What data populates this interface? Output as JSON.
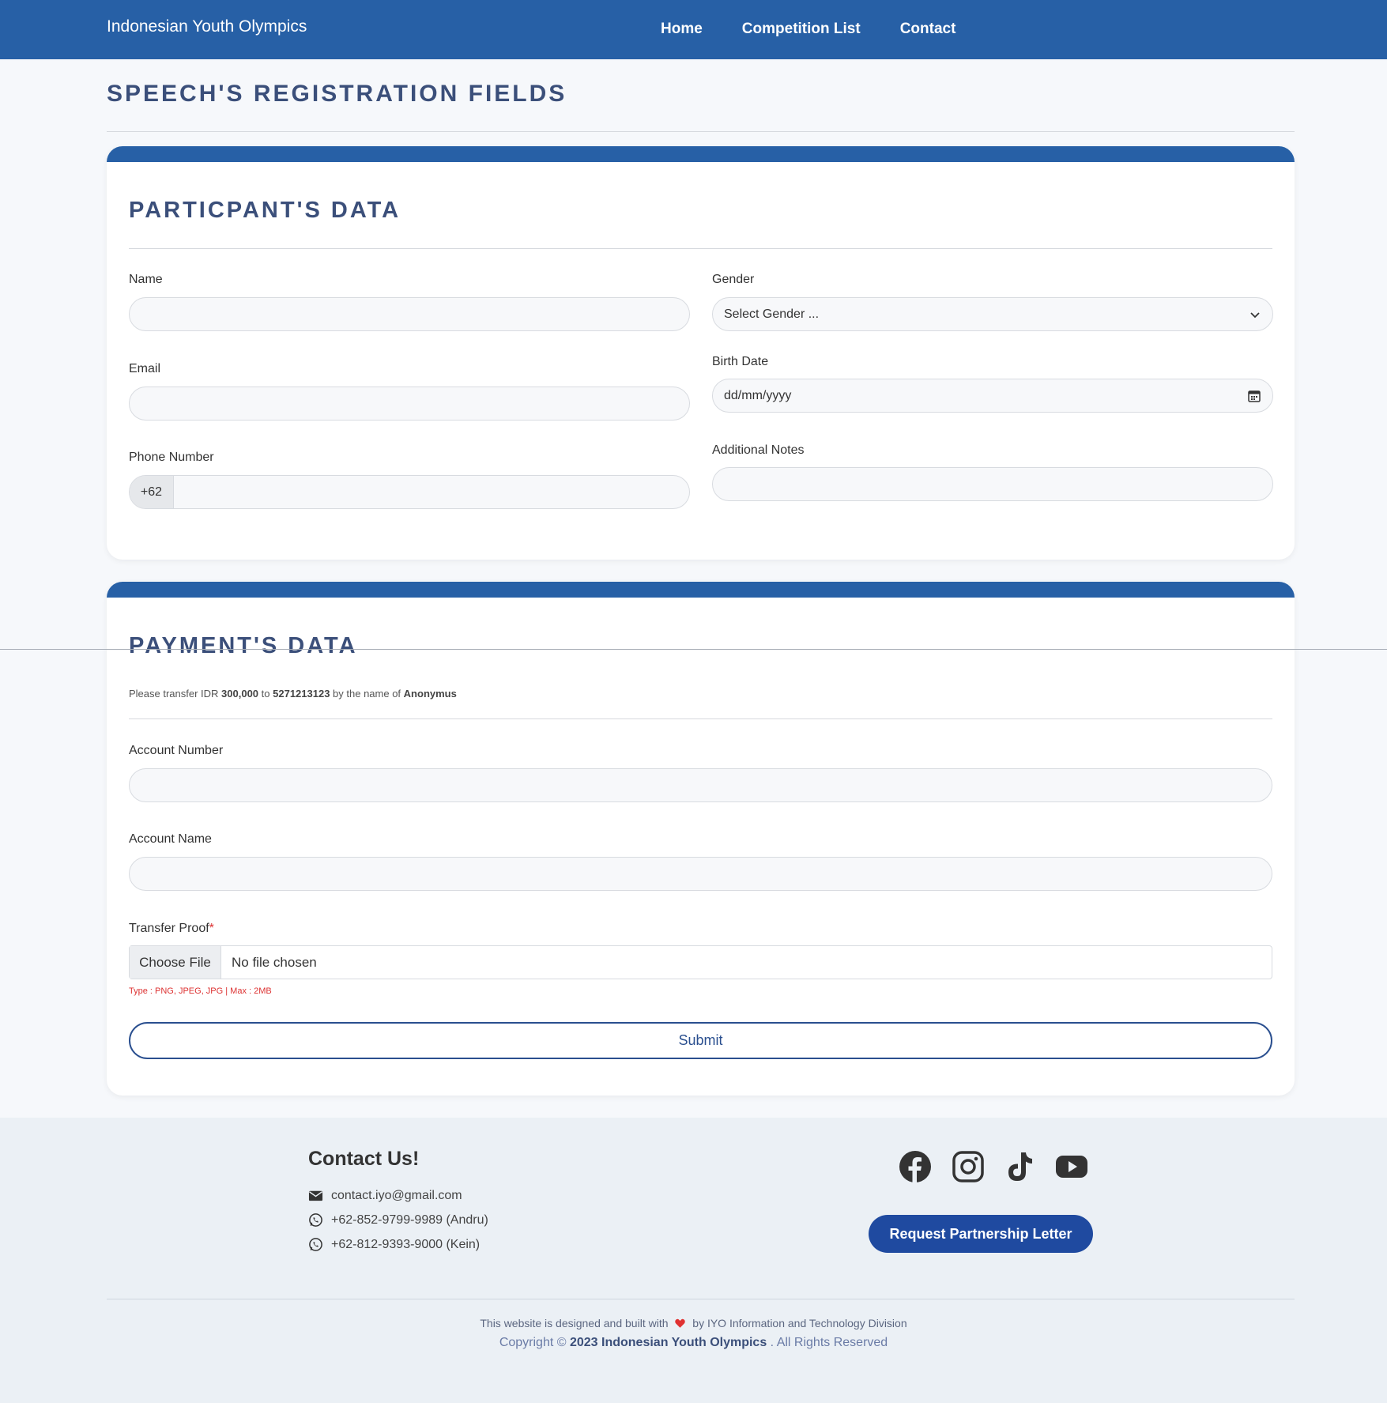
{
  "navbar": {
    "brand": "Indonesian Youth Olympics",
    "links": [
      "Home",
      "Competition List",
      "Contact"
    ]
  },
  "page": {
    "title": "SPEECH'S REGISTRATION FIELDS"
  },
  "participant": {
    "title": "PARTICPANT'S DATA",
    "name_label": "Name",
    "email_label": "Email",
    "phone_label": "Phone Number",
    "phone_prefix": "+62",
    "gender_label": "Gender",
    "gender_placeholder": "Select Gender ...",
    "birth_label": "Birth Date",
    "birth_placeholder": "dd/mm/yyyy",
    "notes_label": "Additional Notes"
  },
  "payment": {
    "title": "PAYMENT'S DATA",
    "note_prefix": "Please transfer IDR ",
    "amount": "300,000",
    "note_to": " to ",
    "account_no": "5271213123",
    "note_by": " by the name of ",
    "account_holder": "Anonymus",
    "account_number_label": "Account Number",
    "account_name_label": "Account Name",
    "proof_label": "Transfer Proof",
    "proof_required": "*",
    "file_button": "Choose File",
    "file_status": "No file chosen",
    "file_hint": "Type : PNG, JPEG, JPG | Max : 2MB",
    "submit": "Submit"
  },
  "footer": {
    "contact_title": "Contact Us!",
    "email": "contact.iyo@gmail.com",
    "phone1": "+62-852-9799-9989 (Andru)",
    "phone2": "+62-812-9393-9000 (Kein)",
    "partner_button": "Request Partnership Letter",
    "credit_before": "This website is designed and built with",
    "credit_after": "by IYO Information and Technology Division",
    "copyright_prefix": "Copyright © ",
    "copyright_bold": "2023 Indonesian Youth Olympics",
    "copyright_suffix": " . All Rights Reserved"
  },
  "colors": {
    "primary": "#2760a6",
    "heading": "#3b4f7a",
    "button": "#1f4aa0",
    "required": "#dd3333"
  }
}
